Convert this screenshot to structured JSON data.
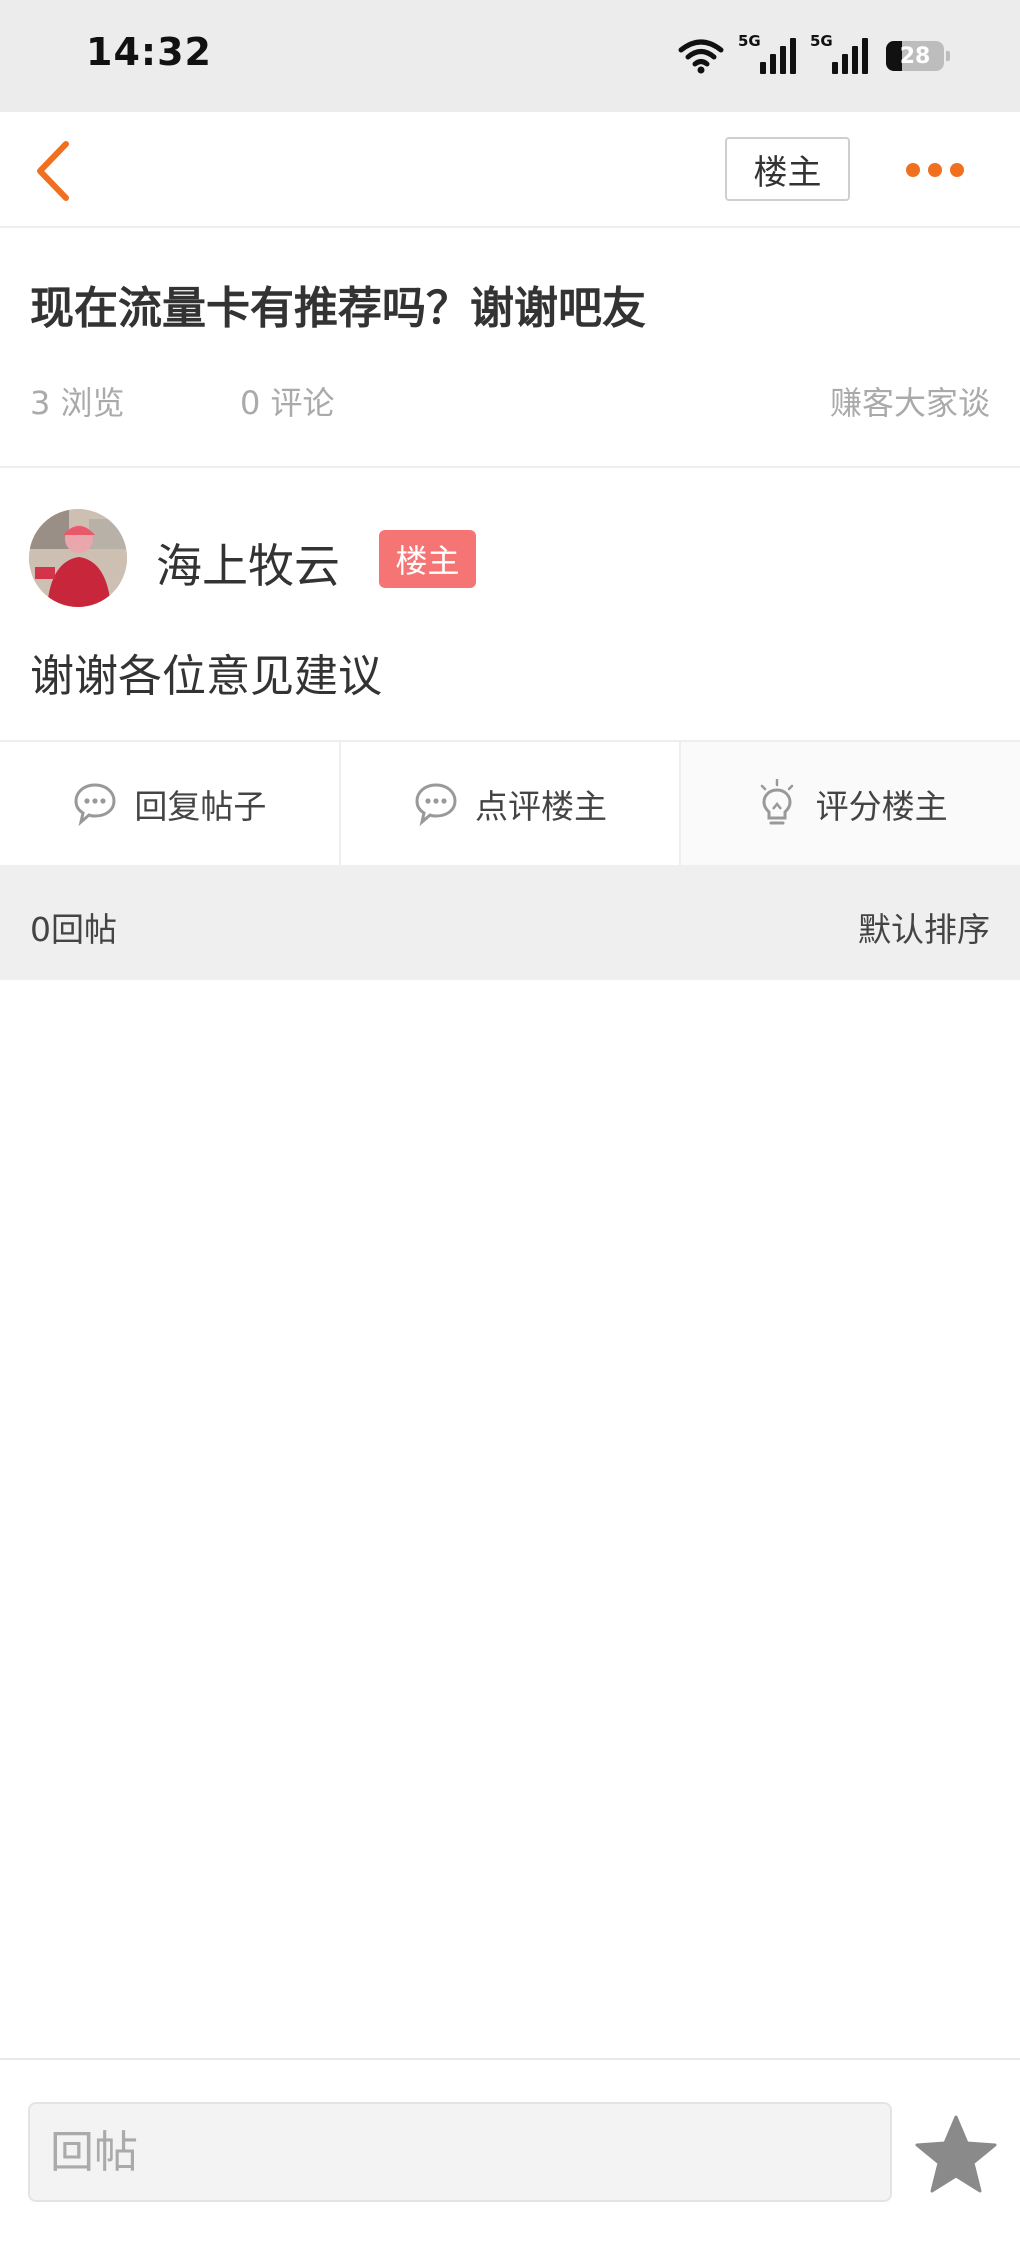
{
  "status_bar": {
    "time": "14:32",
    "network_1": "5G",
    "network_2": "5G",
    "battery": "28"
  },
  "nav": {
    "op_filter_label": "楼主"
  },
  "post": {
    "title": "现在流量卡有推荐吗？谢谢吧友",
    "views": "3 浏览",
    "comments": "0 评论",
    "forum": "赚客大家谈",
    "author": "海上牧云",
    "author_badge": "楼主",
    "body": "谢谢各位意见建议"
  },
  "actions": {
    "reply": "回复帖子",
    "comment_op": "点评楼主",
    "rate_op": "评分楼主"
  },
  "replies": {
    "count": "0回帖",
    "sort": "默认排序"
  },
  "bottom": {
    "reply_placeholder": "回帖"
  },
  "colors": {
    "accent": "#f07020",
    "badge": "#f57575"
  }
}
